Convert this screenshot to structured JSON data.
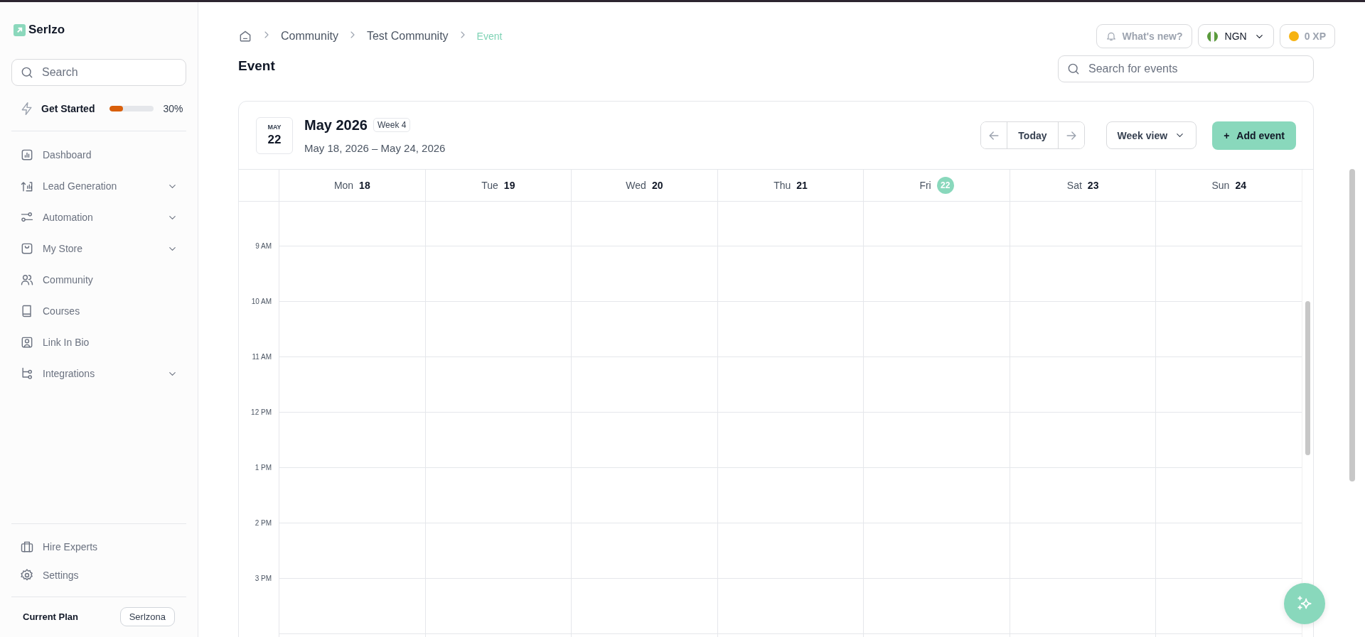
{
  "logo": {
    "name": "Serlzo"
  },
  "sidebar": {
    "search": {
      "placeholder": "Search"
    },
    "get_started": {
      "label": "Get Started",
      "level": 0.3,
      "reading": "30%"
    },
    "items": [
      {
        "label": "Dashboard",
        "expandable": false
      },
      {
        "label": "Lead Generation",
        "expandable": true
      },
      {
        "label": "Automation",
        "expandable": true
      },
      {
        "label": "My Store",
        "expandable": true
      },
      {
        "label": "Community",
        "expandable": false
      },
      {
        "label": "Courses",
        "expandable": false
      },
      {
        "label": "Link In Bio",
        "expandable": false
      },
      {
        "label": "Integrations",
        "expandable": true
      }
    ],
    "footer_items": [
      {
        "label": "Hire Experts"
      },
      {
        "label": "Settings"
      }
    ],
    "plan": {
      "label": "Current Plan",
      "value": "Serlzona"
    }
  },
  "breadcrumb": [
    {
      "label": "Community",
      "current": false
    },
    {
      "label": "Test Community",
      "current": false
    },
    {
      "label": "Event",
      "current": true
    }
  ],
  "top_actions": {
    "whats_new": "What's new?",
    "currency": "NGN",
    "xp": "0 XP"
  },
  "page_title": "Event",
  "event_search": {
    "placeholder": "Search for events"
  },
  "calendar": {
    "badge": {
      "month": "MAY",
      "day": "22"
    },
    "title": "May 2026",
    "week": "Week 4",
    "range": "May 18, 2026 – May 24, 2026",
    "today_button": "Today",
    "view": "Week view",
    "add_button": {
      "icon": "+",
      "label": "Add event"
    },
    "days": [
      {
        "name": "Mon",
        "date": "18",
        "selected": false
      },
      {
        "name": "Tue",
        "date": "19",
        "selected": false
      },
      {
        "name": "Wed",
        "date": "20",
        "selected": false
      },
      {
        "name": "Thu",
        "date": "21",
        "selected": false
      },
      {
        "name": "Fri",
        "date": "22",
        "selected": true
      },
      {
        "name": "Sat",
        "date": "23",
        "selected": false
      },
      {
        "name": "Sun",
        "date": "24",
        "selected": false
      }
    ],
    "hours": [
      "9 AM",
      "10 AM",
      "11 AM",
      "12 PM",
      "1 PM",
      "2 PM",
      "3 PM"
    ]
  }
}
